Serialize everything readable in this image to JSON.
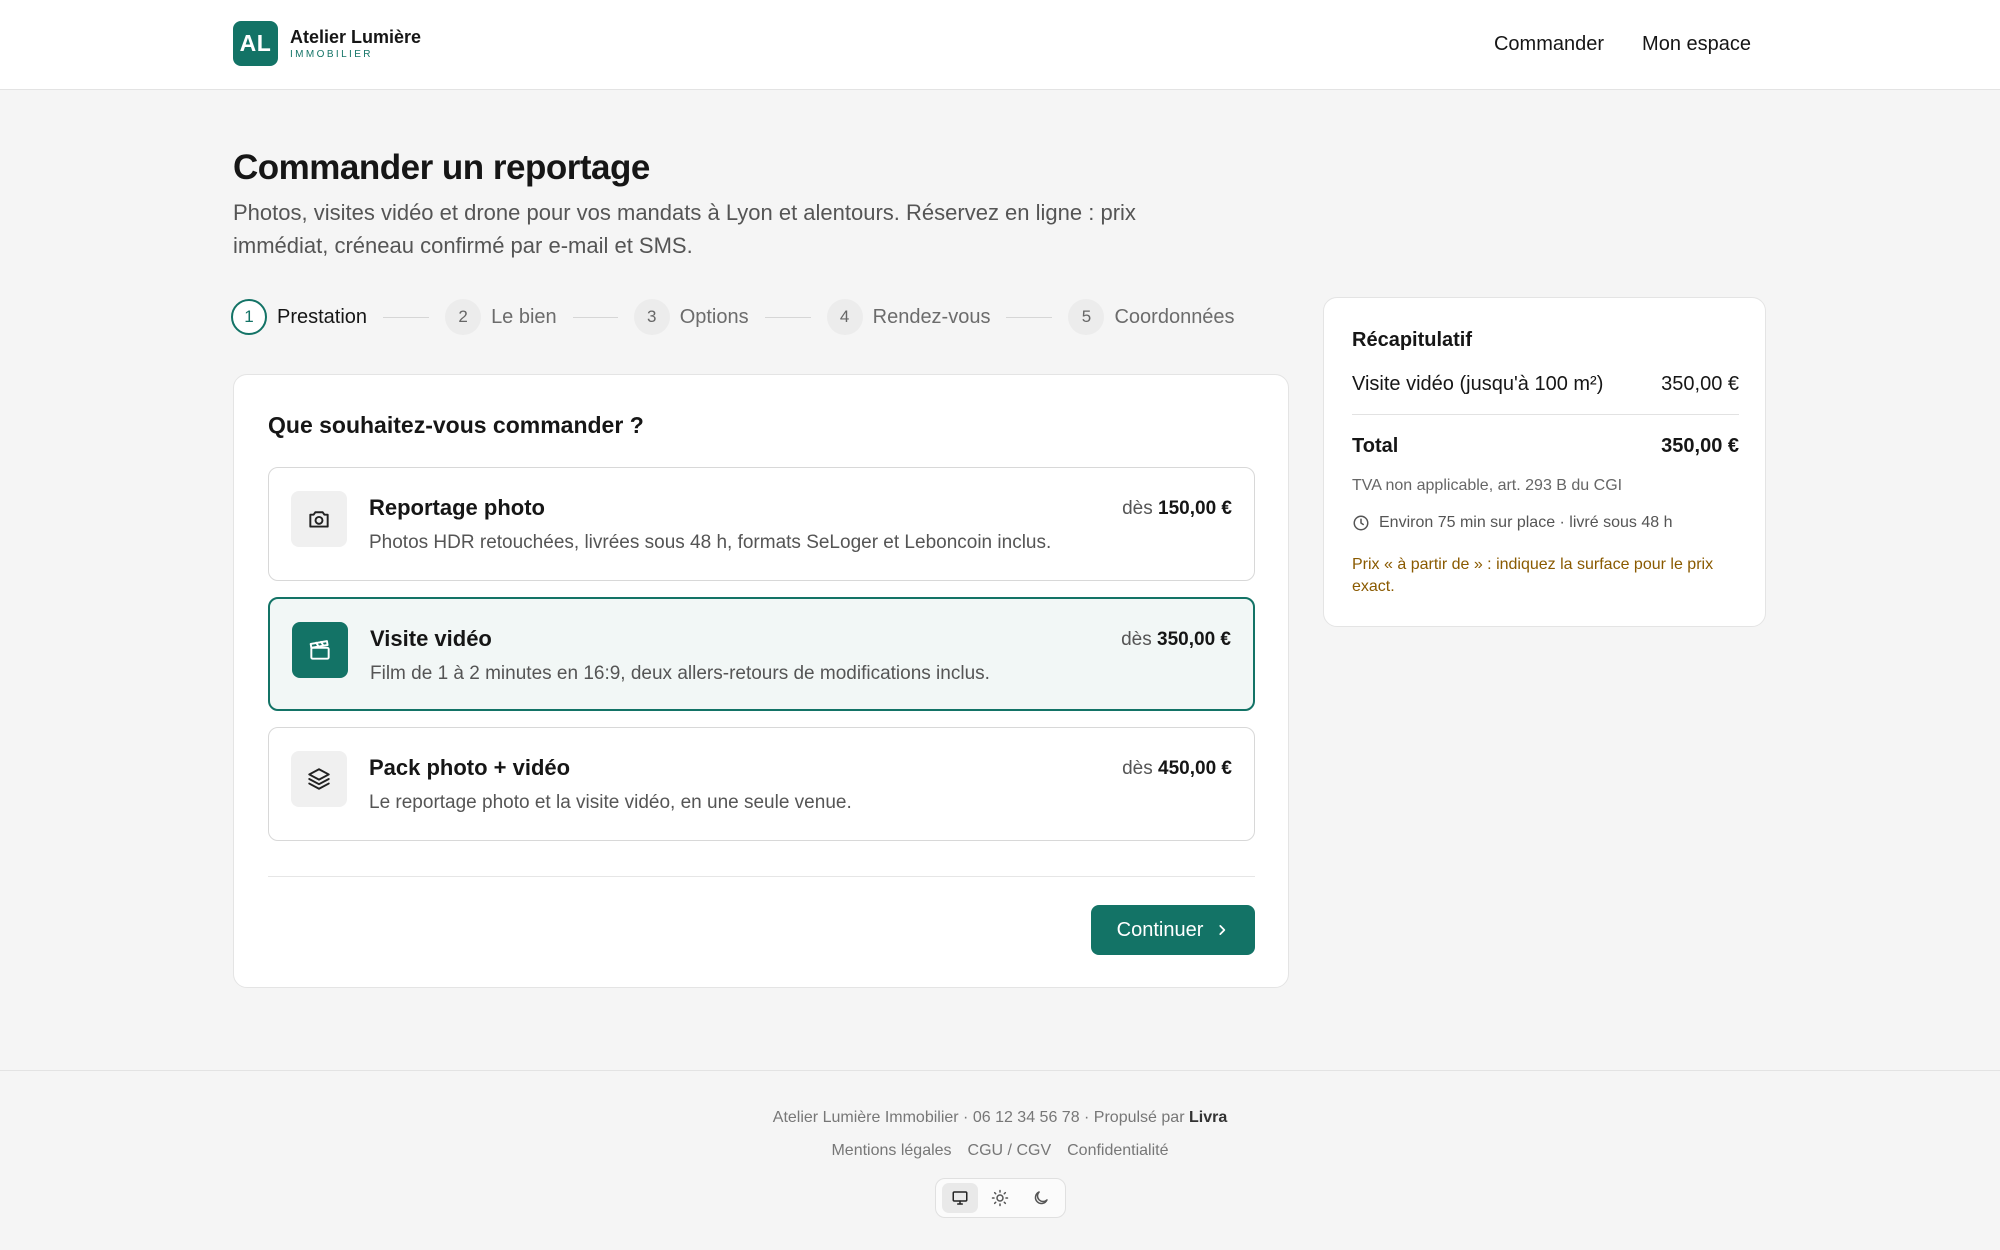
{
  "brand": {
    "initials": "AL",
    "name": "Atelier Lumière",
    "subtitle": "IMMOBILIER"
  },
  "nav": {
    "order_label": "Commander",
    "account_label": "Mon espace"
  },
  "intro": {
    "title": "Commander un reportage",
    "lede": "Photos, visites vidéo et drone pour vos mandats à Lyon et alentours. Réservez en ligne : prix immédiat, créneau confirmé par e-mail et SMS."
  },
  "stepper": {
    "active_step": 1,
    "steps": [
      {
        "num": "1",
        "label": "Prestation"
      },
      {
        "num": "2",
        "label": "Le bien"
      },
      {
        "num": "3",
        "label": "Options"
      },
      {
        "num": "4",
        "label": "Rendez-vous"
      },
      {
        "num": "5",
        "label": "Coordonnées"
      }
    ]
  },
  "order": {
    "question": "Que souhaitez-vous commander ?",
    "price_prefix": "dès",
    "options": [
      {
        "icon": "camera-icon",
        "title": "Reportage photo",
        "desc": "Photos HDR retouchées, livrées sous 48 h, formats SeLoger et Leboncoin inclus.",
        "price": "150,00 €",
        "selected": false
      },
      {
        "icon": "clapperboard-icon",
        "title": "Visite vidéo",
        "desc": "Film de 1 à 2 minutes en 16:9, deux allers-retours de modifications inclus.",
        "price": "350,00 €",
        "selected": true
      },
      {
        "icon": "layers-icon",
        "title": "Pack photo + vidéo",
        "desc": "Le reportage photo et la visite vidéo, en une seule venue.",
        "price": "450,00 €",
        "selected": false
      }
    ],
    "continue_label": "Continuer"
  },
  "summary": {
    "title": "Récapitulatif",
    "item_label": "Visite vidéo (jusqu'à 100 m²)",
    "item_price": "350,00 €",
    "total_label": "Total",
    "total_value": "350,00 €",
    "tva": "TVA non applicable, art. 293 B du CGI",
    "duration": "Environ 75 min sur place · livré sous 48 h",
    "note": "Prix « à partir de » : indiquez la surface pour le prix exact."
  },
  "footer": {
    "line": "Atelier Lumière Immobilier · 06 12 34 56 78 · Propulsé par",
    "powered_by": "Livra",
    "links": [
      "Mentions légales",
      "CGU / CGV",
      "Confidentialité"
    ],
    "theme_active": "system"
  },
  "colors": {
    "accent": "#137366",
    "warning_text": "#8a5a00"
  }
}
